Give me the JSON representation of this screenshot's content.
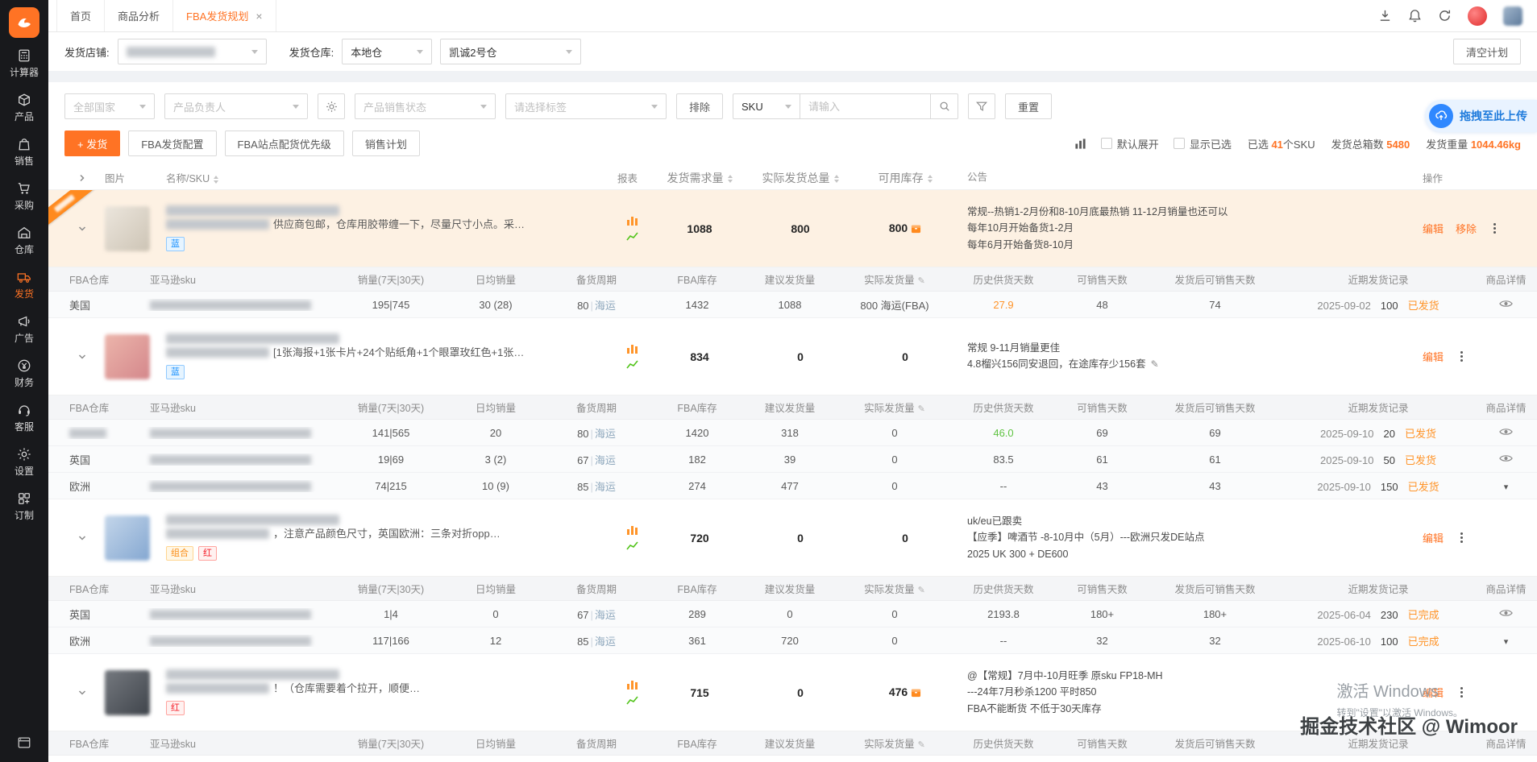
{
  "colors": {
    "accent": "#ff7324",
    "sidebar_bg": "#18191c",
    "highlight_row": "#fdf1e3",
    "link_blue": "#1890ff",
    "green": "#5fc342",
    "status_orange": "#ff9429"
  },
  "sidebar": {
    "items": [
      {
        "id": "calculator",
        "icon": "calculator-icon",
        "label": "计算器"
      },
      {
        "id": "product",
        "icon": "product-icon",
        "label": "产品"
      },
      {
        "id": "sales",
        "icon": "sales-icon",
        "label": "销售"
      },
      {
        "id": "purchase",
        "icon": "purchase-icon",
        "label": "采购"
      },
      {
        "id": "warehouse",
        "icon": "warehouse-icon",
        "label": "仓库"
      },
      {
        "id": "shipping",
        "icon": "shipping-icon",
        "label": "发货",
        "active": true
      },
      {
        "id": "ads",
        "icon": "ads-icon",
        "label": "广告"
      },
      {
        "id": "finance",
        "icon": "finance-icon",
        "label": "财务"
      },
      {
        "id": "service",
        "icon": "service-icon",
        "label": "客服"
      },
      {
        "id": "settings",
        "icon": "settings-icon",
        "label": "设置"
      },
      {
        "id": "custom",
        "icon": "custom-icon",
        "label": "订制"
      }
    ]
  },
  "tabbar": {
    "tabs": [
      {
        "label": "首页"
      },
      {
        "label": "商品分析"
      },
      {
        "label": "FBA发货规划",
        "active": true,
        "closable": true
      }
    ]
  },
  "toolbar": {
    "store_label": "发货店铺:",
    "warehouse_label": "发货仓库:",
    "warehouse_type": "本地仓",
    "warehouse_name": "凯诚2号仓",
    "clear_plan": "清空计划"
  },
  "filters": {
    "country": "全部国家",
    "owner": "产品负责人",
    "sale_status": "产品销售状态",
    "tag_placeholder": "请选择标签",
    "exclude": "排除",
    "search_type": "SKU",
    "input_placeholder": "请输入",
    "reset": "重置",
    "upload": "拖拽至此上传"
  },
  "actions": {
    "ship": "+ 发货",
    "fba_config": "FBA发货配置",
    "fba_priority": "FBA站点配货优先级",
    "sales_plan": "销售计划",
    "default_expand": "默认展开",
    "show_selected": "显示已选",
    "selected_label": "已选 ",
    "selected_value": "41",
    "selected_suffix": "个SKU",
    "total_label": "发货总箱数 ",
    "total_value": "5480",
    "weight_label": "发货重量 ",
    "weight_value": "1044.46kg"
  },
  "table": {
    "headers": {
      "image": "图片",
      "name": "名称/SKU",
      "report": "报表",
      "demand": "发货需求量",
      "actual": "实际发货总量",
      "available": "可用库存",
      "announce": "公告",
      "ops": "操作"
    },
    "sub_headers": [
      "FBA仓库",
      "亚马逊sku",
      "销量(7天|30天)",
      "日均销量",
      "备货周期",
      "FBA库存",
      "建议发货量",
      "实际发货量",
      "历史供货天数",
      "可销售天数",
      "发货后可销售天数",
      "近期发货记录",
      "商品详情"
    ],
    "groups": [
      {
        "highlight": true,
        "ribbon": true,
        "image_tint": "light",
        "name_suffix": "供应商包邮，仓库用胶带缠一下，尽量尺寸小点。采…",
        "tags": [
          {
            "label": "蓝",
            "type": "blue"
          }
        ],
        "demand": "1088",
        "actual_total": "800",
        "available": "800",
        "available_icon": true,
        "announcement": [
          "常规--热销1-2月份和8-10月底最热销 11-12月销量也还可以",
          "每年10月开始备货1-2月",
          "每年6月开始备货8-10月"
        ],
        "ops": {
          "edit": "编辑",
          "remove": "移除"
        },
        "sub_rows": [
          {
            "warehouse": "美国",
            "sales": "195|745",
            "daily": "30 (28)",
            "cycle": "80",
            "cycle_mode": "海运",
            "fba": "1432",
            "suggest": "1088",
            "actual": "800 海运(FBA)",
            "history": "27.9",
            "history_color": "orange",
            "days": "48",
            "after_days": "74",
            "record_date": "2025-09-02",
            "record_qty": "100",
            "record_status": "已发货",
            "detail": "eye"
          }
        ]
      },
      {
        "image_tint": "pink",
        "name_suffix": "[1张海报+1张卡片+24个贴纸角+1个眼罩玫红色+1张…",
        "tags": [
          {
            "label": "蓝",
            "type": "blue"
          }
        ],
        "demand": "834",
        "actual_total": "0",
        "available": "0",
        "announcement": [
          "常规 9-11月销量更佳",
          "4.8榴兴156同安退回，在途库存少156套"
        ],
        "announcement_edit_icon": true,
        "ops": {
          "edit": "编辑"
        },
        "sub_rows": [
          {
            "warehouse_blurred": true,
            "sales": "141|565",
            "daily": "20",
            "cycle": "80",
            "cycle_mode": "海运",
            "fba": "1420",
            "suggest": "318",
            "actual": "0",
            "history": "46.0",
            "history_color": "green",
            "days": "69",
            "after_days": "69",
            "record_date": "2025-09-10",
            "record_qty": "20",
            "record_status": "已发货",
            "detail": "eye"
          },
          {
            "warehouse": "英国",
            "sales": "19|69",
            "daily": "3 (2)",
            "cycle": "67",
            "cycle_mode": "海运",
            "fba": "182",
            "suggest": "39",
            "actual": "0",
            "history": "83.5",
            "days": "61",
            "after_days": "61",
            "record_date": "2025-09-10",
            "record_qty": "50",
            "record_status": "已发货",
            "detail": "eye"
          },
          {
            "warehouse": "欧洲",
            "sales": "74|215",
            "daily": "10 (9)",
            "cycle": "85",
            "cycle_mode": "海运",
            "fba": "274",
            "suggest": "477",
            "actual": "0",
            "history": "--",
            "days": "43",
            "after_days": "43",
            "record_date": "2025-09-10",
            "record_qty": "150",
            "record_status": "已发货",
            "detail": "caret"
          }
        ]
      },
      {
        "image_tint": "blue",
        "name_suffix": "，注意产品颜色尺寸，英国欧洲：三条对折opp…",
        "tags": [
          {
            "label": "组合",
            "type": "orange"
          },
          {
            "label": "红",
            "type": "red"
          }
        ],
        "demand": "720",
        "actual_total": "0",
        "available": "0",
        "announcement": [
          "uk/eu已跟卖",
          "【应季】啤酒节 -8-10月中（5月）---欧洲只发DE站点",
          "2025 UK 300 + DE600"
        ],
        "ops": {
          "edit": "编辑"
        },
        "sub_rows": [
          {
            "warehouse": "英国",
            "sales": "1|4",
            "daily": "0",
            "cycle": "67",
            "cycle_mode": "海运",
            "fba": "289",
            "suggest": "0",
            "actual": "0",
            "history": "2193.8",
            "days": "180+",
            "after_days": "180+",
            "record_date": "2025-06-04",
            "record_qty": "230",
            "record_status": "已完成",
            "detail": "eye"
          },
          {
            "warehouse": "欧洲",
            "sales": "117|166",
            "daily": "12",
            "cycle": "85",
            "cycle_mode": "海运",
            "fba": "361",
            "suggest": "720",
            "actual": "0",
            "history": "--",
            "days": "32",
            "after_days": "32",
            "record_date": "2025-06-10",
            "record_qty": "100",
            "record_status": "已完成",
            "detail": "caret"
          }
        ]
      },
      {
        "image_tint": "dark",
        "name_suffix": "！（仓库需要着个拉开，顺便…",
        "tags": [
          {
            "label": "红",
            "type": "red"
          }
        ],
        "demand": "715",
        "actual_total": "0",
        "available": "476",
        "available_icon": true,
        "announcement": [
          "@【常规】7月中-10月旺季 原sku FP18-MH",
          "---24年7月秒杀1200 平时850",
          "FBA不能断货 不低于30天库存"
        ],
        "ops": {
          "edit": "编辑"
        },
        "sub_rows": []
      }
    ]
  },
  "watermark": {
    "line1": "激活 Windows",
    "line2": "转到\"设置\"以激活 Windows。",
    "brand": "掘金技术社区 @ Wimoor"
  }
}
